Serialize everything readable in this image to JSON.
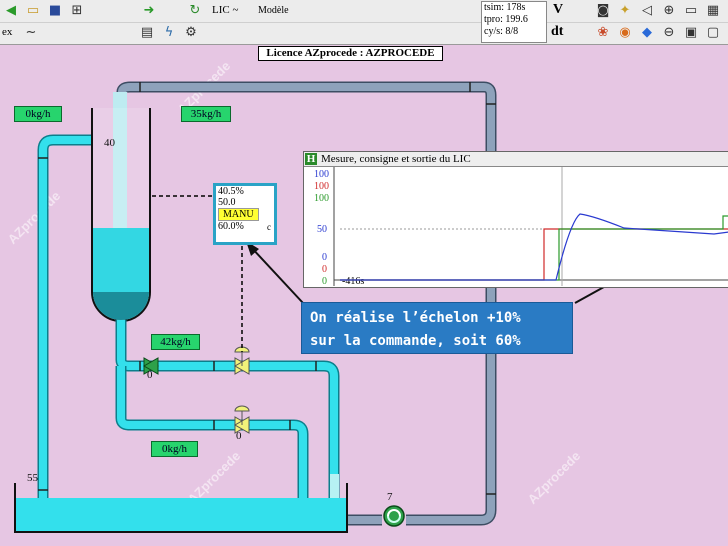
{
  "toolbar": {
    "lic_label": "LIC ~",
    "model_label": "Modèle",
    "ex_label": "ex",
    "v_label": "V",
    "dt_label": "dt",
    "icons": [
      "back-icon",
      "open-folder-icon",
      "save-icon",
      "tree-icon",
      "forward-icon",
      "refresh-icon",
      "grid-icon",
      "lightning-icon",
      "pump-icon",
      "camera-icon",
      "settings-icon",
      "sound-icon",
      "zoom-in-icon",
      "monitor-icon",
      "print-icon",
      "palette-icon",
      "browser-icon",
      "cube-icon",
      "zoom-out-icon",
      "frame-icon"
    ]
  },
  "status": {
    "tsim": "tsim: 178s",
    "tpro": "tpro: 199.6",
    "cys": "cy/s: 8/8"
  },
  "licence": "Licence AZprocede : AZPROCEDE",
  "flows": {
    "top_left": "0kg/h",
    "top_right": "35kg/h",
    "mid": "42kg/h",
    "bottom": "0kg/h"
  },
  "levels": {
    "tank_top": "40",
    "sump": "55",
    "pump": "7",
    "valve1": "0",
    "valve2": "0"
  },
  "lic": {
    "pv": "40.5%",
    "sp": "50.0",
    "mode": "MANU",
    "out": "60.0%",
    "flag": "c"
  },
  "trend": {
    "title": "Mesure, consigne et sortie du LIC",
    "left_labels": [
      "100",
      "100",
      "100",
      "50",
      "0",
      "0",
      "0"
    ],
    "time_label": "-416s"
  },
  "callout": [
    "On réalise l’échelon +10%",
    "sur la commande, soit 60%"
  ],
  "watermark": "AZprocede",
  "colors": {
    "pipe": "#33e0ec",
    "pipe_border": "#0b7f8c",
    "grey_pipe": "#7f95b0",
    "accent": "#2a7bc4"
  }
}
